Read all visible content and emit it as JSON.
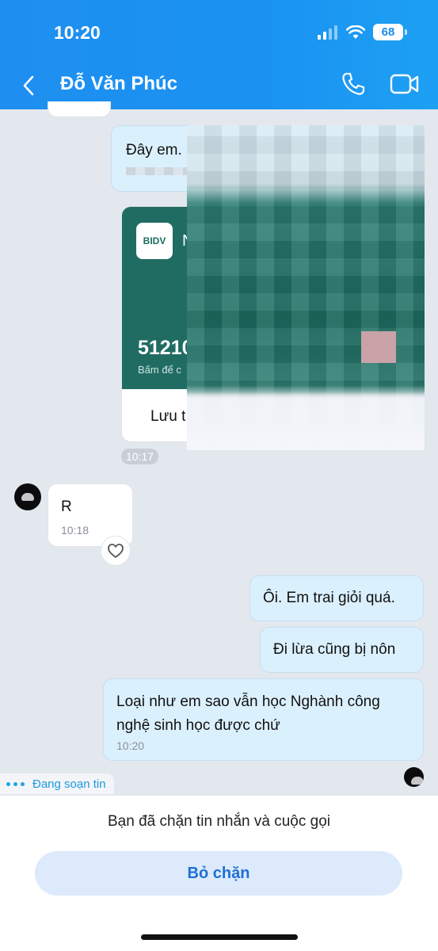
{
  "status_bar": {
    "time": "10:20",
    "battery": "68"
  },
  "header": {
    "title": "Đỗ Văn Phúc"
  },
  "messages": {
    "m1_text": "Đây em.",
    "card": {
      "bank": "BIDV",
      "name_partial": "N",
      "number_partial": "51210",
      "hint_partial": "Bấm để c",
      "save_partial": "Lưu t",
      "time": "10:17"
    },
    "m2_text": "R",
    "m2_time": "10:18",
    "m3_text": "Ôi. Em trai giỏi quá.",
    "m4_text": "Đi lừa cũng bị nôn",
    "m5_text": "Loại như em sao vẫn học Nghành công nghệ sinh học được chứ",
    "m5_time": "10:20"
  },
  "typing": {
    "label": "Đang soạn tin"
  },
  "footer": {
    "blocked_text": "Bạn đã chặn tin nhắn và cuộc gọi",
    "unblock_label": "Bỏ chặn"
  },
  "colors": {
    "header_blue": "#1e8ff0",
    "bubble_out": "#dbf0fd",
    "accent_blue": "#1f6fd6",
    "card_green": "#206c63"
  }
}
